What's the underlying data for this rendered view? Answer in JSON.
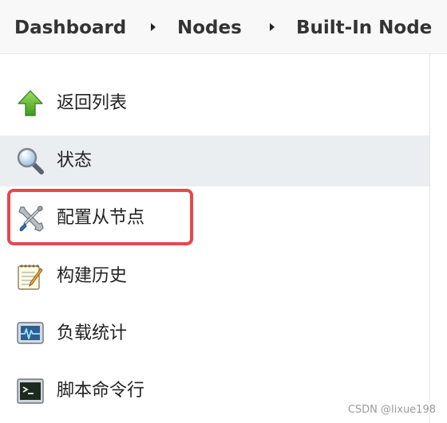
{
  "breadcrumb": {
    "items": [
      {
        "label": "Dashboard"
      },
      {
        "label": "Nodes"
      },
      {
        "label": "Built-In Node"
      }
    ]
  },
  "sidebar": {
    "items": [
      {
        "label": "返回列表",
        "icon": "up-arrow-icon",
        "active": false
      },
      {
        "label": "状态",
        "icon": "magnifier-icon",
        "active": true
      },
      {
        "label": "配置从节点",
        "icon": "wrench-screwdriver-icon",
        "active": false,
        "highlighted": true
      },
      {
        "label": "构建历史",
        "icon": "notepad-pencil-icon",
        "active": false
      },
      {
        "label": "负载统计",
        "icon": "monitor-graph-icon",
        "active": false
      },
      {
        "label": "脚本命令行",
        "icon": "terminal-icon",
        "active": false
      }
    ]
  },
  "colors": {
    "highlight_border": "#e9474e",
    "active_background": "#eaeef1",
    "breadcrumb_background": "#f8f8f8"
  },
  "watermark": "CSDN @lixue198"
}
